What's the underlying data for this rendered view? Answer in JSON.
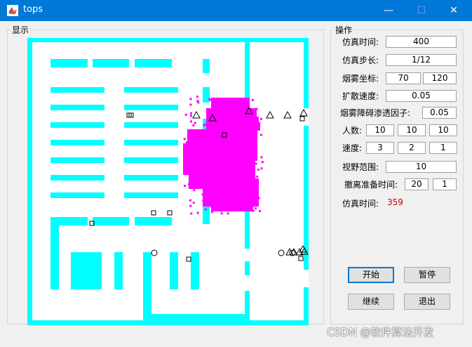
{
  "window": {
    "title": "tops",
    "minimize": "—",
    "maximize": "☐",
    "close": "✕"
  },
  "display_panel": {
    "title": "显示"
  },
  "ops_panel": {
    "title": "操作",
    "sim_duration_label": "仿真时间:",
    "sim_duration": "400",
    "step_label": "仿真步长:",
    "step": "1/12",
    "smoke_coord_label": "烟雾坐标:",
    "smoke_x": "70",
    "smoke_y": "120",
    "diffusion_label": "扩散速度:",
    "diffusion": "0.05",
    "penetration_label": "烟雾障碍渗透因子:",
    "penetration": "0.05",
    "people_label": "人数:",
    "people": [
      "10",
      "10",
      "10"
    ],
    "speed_label": "速度:",
    "speed": [
      "3",
      "2",
      "1"
    ],
    "vision_label": "视野范围:",
    "vision": "10",
    "prep_label": "撤离准备时间:",
    "prep": [
      "20",
      "1"
    ],
    "current_time_label": "仿真时间:",
    "current_time": "359",
    "start_button": "开始",
    "pause_button": "暂停",
    "resume_button": "继续",
    "exit_button": "退出"
  },
  "colors": {
    "wall": "#00ffff",
    "smoke": "#ff00ff",
    "title_bar": "#0078d7",
    "time_value": "#c00000"
  },
  "map_agents": {
    "squares": 10,
    "triangles": 12,
    "circles": 3
  },
  "watermark": "CSDN @软件算法开发"
}
